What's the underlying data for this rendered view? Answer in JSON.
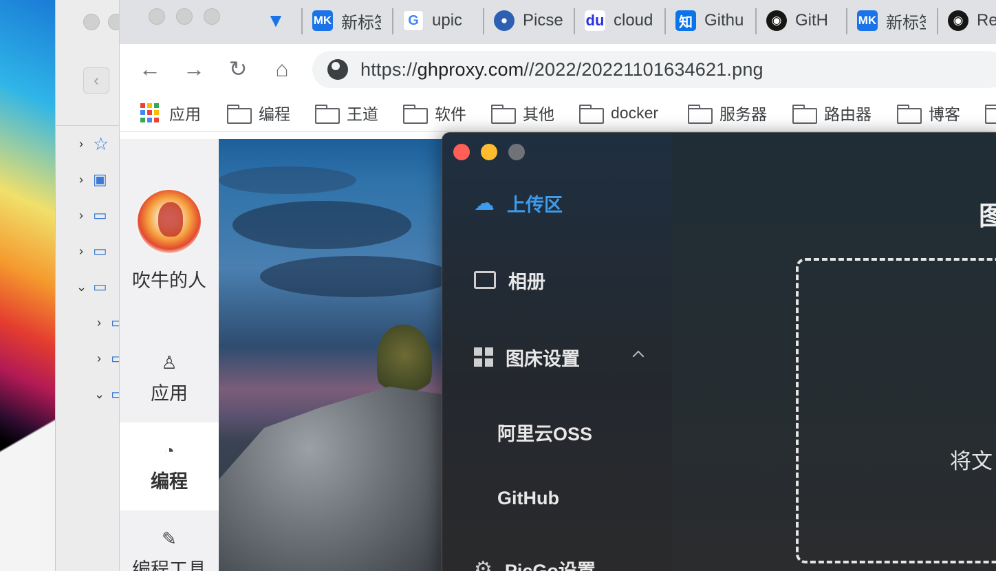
{
  "browser": {
    "tabs": [
      {
        "label": "",
        "icon": "filter-icon",
        "color": "#1a73e8"
      },
      {
        "label": "新标签",
        "icon": "mk-icon",
        "color": "#1a73e8"
      },
      {
        "label": "upic",
        "icon": "google-icon",
        "color": "#4285f4"
      },
      {
        "label": "Picse",
        "icon": "picsee-icon",
        "color": "#2d5fb3"
      },
      {
        "label": "cloud",
        "icon": "baidu-icon",
        "color": "#2932e1"
      },
      {
        "label": "Githu",
        "icon": "zhihu-icon",
        "color": "#0a74e8"
      },
      {
        "label": "GitH",
        "icon": "github-icon",
        "color": "#161614"
      },
      {
        "label": "新标签",
        "icon": "mk-icon",
        "color": "#1a73e8"
      },
      {
        "label": "Re",
        "icon": "github-icon",
        "color": "#161614"
      }
    ],
    "url": {
      "scheme": "https://",
      "host": "ghproxy.com",
      "path": "//2022/20221101634621.png"
    },
    "bookmarks": [
      {
        "label": "应用",
        "icon": "apps-grid-icon"
      },
      {
        "label": "编程",
        "icon": "folder-icon"
      },
      {
        "label": "王道",
        "icon": "folder-icon"
      },
      {
        "label": "软件",
        "icon": "folder-icon"
      },
      {
        "label": "其他",
        "icon": "folder-icon"
      },
      {
        "label": "docker",
        "icon": "folder-icon"
      },
      {
        "label": "服务器",
        "icon": "folder-icon"
      },
      {
        "label": "路由器",
        "icon": "folder-icon"
      },
      {
        "label": "博客",
        "icon": "folder-icon"
      }
    ]
  },
  "webpage": {
    "user_name": "吹牛的人",
    "nav": [
      {
        "label": "应用",
        "icon": "user-icon"
      },
      {
        "label": "编程",
        "icon": "pie-chart-icon"
      },
      {
        "label": "编程工具",
        "icon": "wrench-icon"
      }
    ]
  },
  "picgo": {
    "menu": {
      "upload": "上传区",
      "album": "相册",
      "bed_settings": "图床设置",
      "aliyun": "阿里云OSS",
      "github": "GitHub",
      "picgo_settings": "PicGo设置"
    },
    "main_title": "图",
    "drop_hint": "将文"
  },
  "colors": {
    "accent": "#3c9cf0",
    "close": "#ff5f57",
    "minimize": "#febc2e",
    "zoom": "#6f7378"
  }
}
